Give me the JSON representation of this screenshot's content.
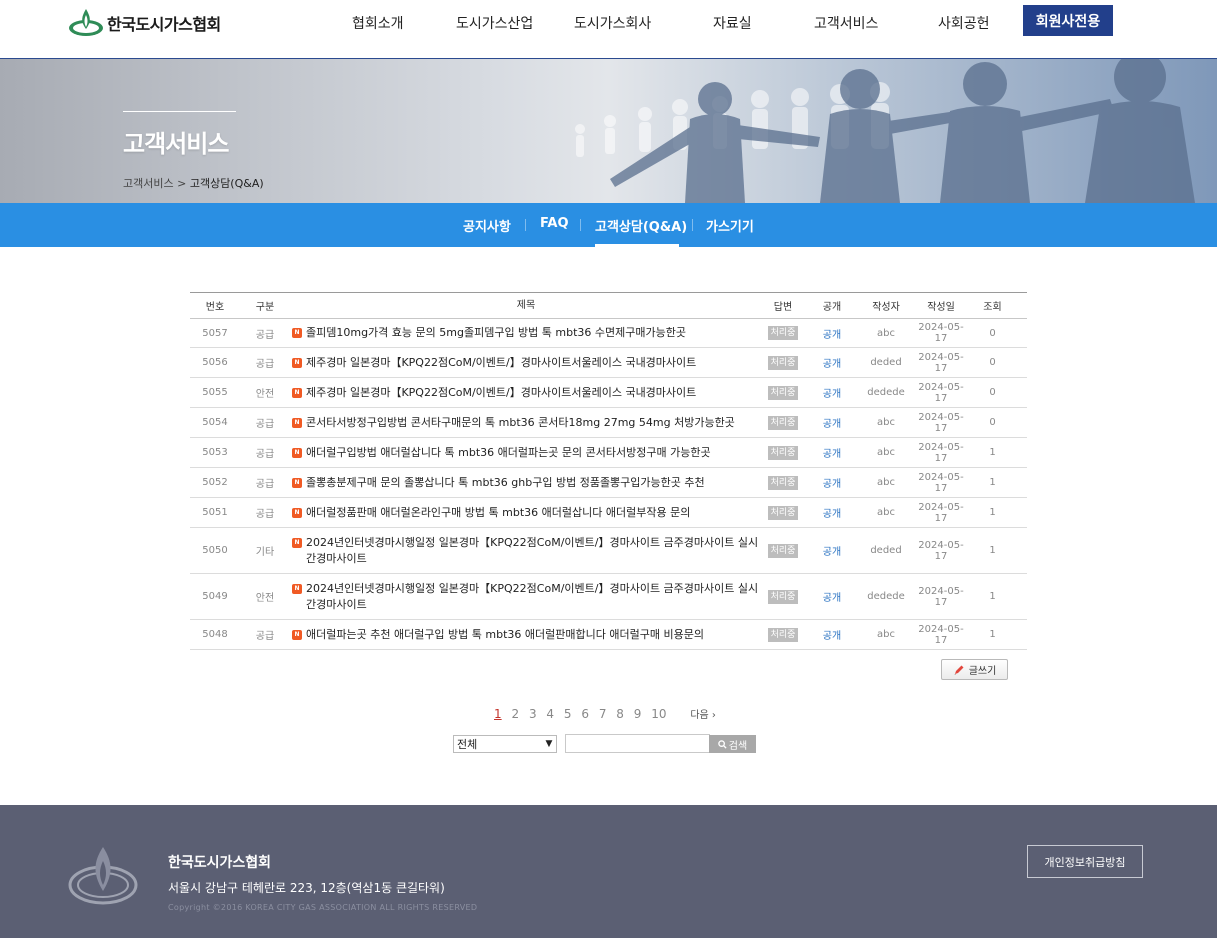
{
  "header": {
    "logo_text": "한국도시가스협회",
    "nav": [
      "협회소개",
      "도시가스산업",
      "도시가스회사",
      "자료실",
      "고객서비스",
      "사회공헌"
    ],
    "member_button": "회원사전용"
  },
  "banner": {
    "title": "고객서비스",
    "breadcrumb": [
      "고객서비스",
      "고객상담(Q&A)"
    ]
  },
  "subnav": {
    "items": [
      "공지사항",
      "FAQ",
      "고객상담(Q&A)",
      "가스기기"
    ],
    "active": "고객상담(Q&A)"
  },
  "board": {
    "headers": {
      "no": "번호",
      "cat": "구분",
      "subject": "제목",
      "answer": "답변",
      "open": "공개",
      "writer": "작성자",
      "date": "작성일",
      "views": "조회"
    },
    "new_icon": "N",
    "rows": [
      {
        "no": "5057",
        "cat": "공급",
        "subject": "졸피뎀10mg가격 효능 문의 5mg졸피뎀구입 방법 톡 mbt36 수면제구매가능한곳",
        "answer": "처리중",
        "open": "공개",
        "writer": "abc",
        "date": "2024-05-17",
        "views": "0"
      },
      {
        "no": "5056",
        "cat": "공급",
        "subject": "제주경마 일본경마【KPQ22점CoM/이벤트/】경마사이트서울레이스 국내경마사이트",
        "answer": "처리중",
        "open": "공개",
        "writer": "deded",
        "date": "2024-05-17",
        "views": "0"
      },
      {
        "no": "5055",
        "cat": "안전",
        "subject": "제주경마 일본경마【KPQ22점CoM/이벤트/】경마사이트서울레이스 국내경마사이트",
        "answer": "처리중",
        "open": "공개",
        "writer": "dedede",
        "date": "2024-05-17",
        "views": "0"
      },
      {
        "no": "5054",
        "cat": "공급",
        "subject": "콘서타서방정구입방법 콘서타구매문의 톡 mbt36 콘서타18mg 27mg 54mg 처방가능한곳",
        "answer": "처리중",
        "open": "공개",
        "writer": "abc",
        "date": "2024-05-17",
        "views": "0"
      },
      {
        "no": "5053",
        "cat": "공급",
        "subject": "애더럴구입방법 애더럴삽니다 톡 mbt36 애더럴파는곳 문의 콘서타서방정구매 가능한곳",
        "answer": "처리중",
        "open": "공개",
        "writer": "abc",
        "date": "2024-05-17",
        "views": "1"
      },
      {
        "no": "5052",
        "cat": "공급",
        "subject": "졸뽕총분제구매 문의 졸뽕삽니다 톡 mbt36 ghb구입 방법 정품졸뽕구입가능한곳 추천",
        "answer": "처리중",
        "open": "공개",
        "writer": "abc",
        "date": "2024-05-17",
        "views": "1"
      },
      {
        "no": "5051",
        "cat": "공급",
        "subject": "애더럴정품판매 애더럴온라인구매 방법 톡 mbt36 애더럴삽니다 애더럴부작용 문의",
        "answer": "처리중",
        "open": "공개",
        "writer": "abc",
        "date": "2024-05-17",
        "views": "1"
      },
      {
        "no": "5050",
        "cat": "기타",
        "subject": "2024년인터넷경마시행일정 일본경마【KPQ22점CoM/이벤트/】경마사이트 금주경마사이트 실시간경마사이트",
        "answer": "처리중",
        "open": "공개",
        "writer": "deded",
        "date": "2024-05-17",
        "views": "1"
      },
      {
        "no": "5049",
        "cat": "안전",
        "subject": "2024년인터넷경마시행일정 일본경마【KPQ22점CoM/이벤트/】경마사이트 금주경마사이트 실시간경마사이트",
        "answer": "처리중",
        "open": "공개",
        "writer": "dedede",
        "date": "2024-05-17",
        "views": "1"
      },
      {
        "no": "5048",
        "cat": "공급",
        "subject": "애더럴파는곳 추천 애더럴구입 방법 톡 mbt36 애더럴판매합니다 애더럴구매 비용문의",
        "answer": "처리중",
        "open": "공개",
        "writer": "abc",
        "date": "2024-05-17",
        "views": "1"
      }
    ],
    "write_button": "글쓰기"
  },
  "pagination": {
    "pages": [
      "1",
      "2",
      "3",
      "4",
      "5",
      "6",
      "7",
      "8",
      "9",
      "10"
    ],
    "current": "1",
    "next_label": "다음 ›"
  },
  "search": {
    "select_value": "전체",
    "input_value": "",
    "button": "검색"
  },
  "footer": {
    "name": "한국도시가스협회",
    "address": "서울시 강남구 테헤란로 223, 12층(역삼1동 큰길타워)",
    "copyright": "Copyright ©2016 KOREA CITY GAS ASSOCIATION ALL RIGHTS RESERVED",
    "privacy_button": "개인정보취급방침"
  },
  "colors": {
    "header_border": "#2b4a8f",
    "member_button": "#223f8b",
    "subnav": "#2a8fe3",
    "new_icon": "#f05a24",
    "open_link": "#2a72c2",
    "footer": "#5b5f73"
  }
}
